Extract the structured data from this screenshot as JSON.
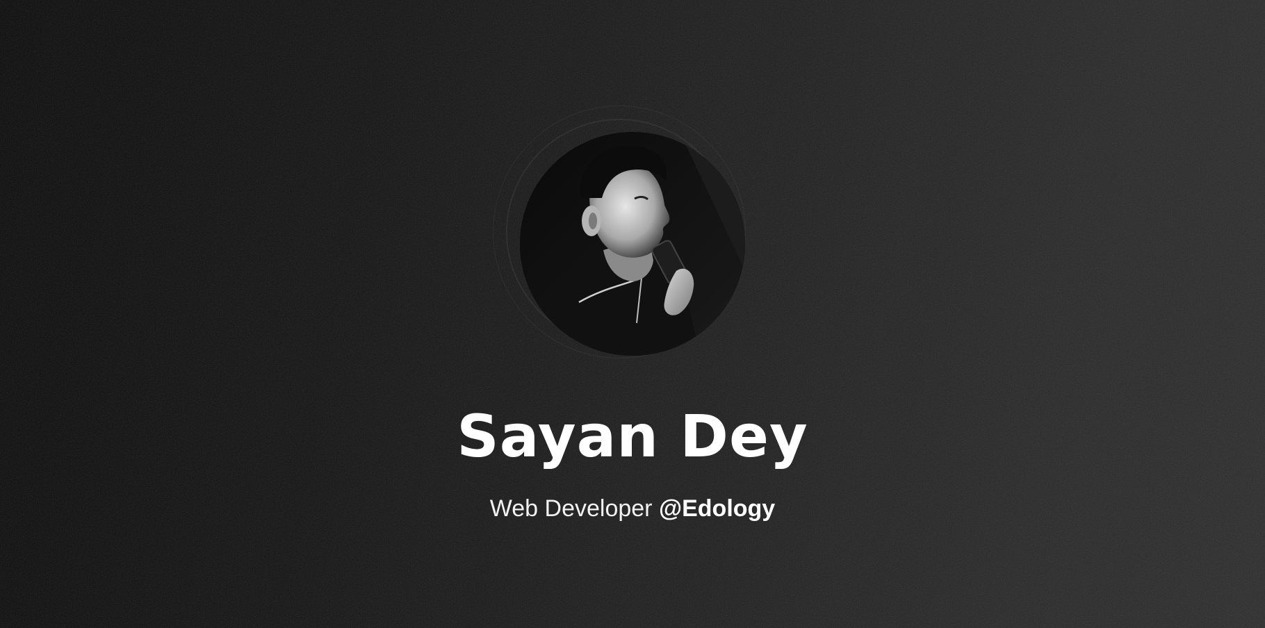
{
  "profile": {
    "name": "Sayan Dey",
    "role": "Web Developer",
    "company": "@Edology",
    "avatar_icon": "profile-photo"
  },
  "colors": {
    "background_dark": "#080808",
    "background_light": "#2a2a2a",
    "text": "#ffffff"
  }
}
